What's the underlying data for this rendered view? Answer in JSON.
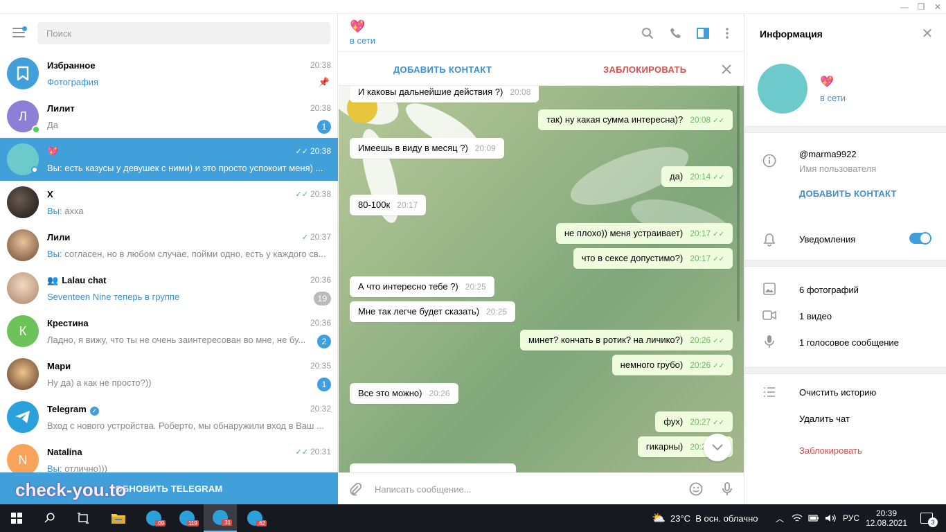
{
  "search": {
    "placeholder": "Поиск"
  },
  "chats": [
    {
      "name": "Избранное",
      "time": "20:38",
      "preview": "Фотография",
      "preview_you": "",
      "badge": "",
      "pinned": true
    },
    {
      "name": "Лилит",
      "time": "20:38",
      "preview": "Да",
      "preview_you": "",
      "badge": "1",
      "initial": "Л"
    },
    {
      "name": "💖",
      "time": "20:38",
      "preview": "есть казусы у девушек с ними) и это просто успокоит меня) ...",
      "preview_you": "Вы: ",
      "badge": ""
    },
    {
      "name": "X",
      "time": "20:38",
      "preview": "ахха",
      "preview_you": "Вы: ",
      "badge": ""
    },
    {
      "name": "Лили",
      "time": "20:37",
      "preview": "согласен, но в любом случае, пойми одно, есть у каждого св...",
      "preview_you": "Вы: ",
      "badge": ""
    },
    {
      "name": "Lalau chat",
      "time": "20:36",
      "preview": "Seventeen Nine теперь в группе",
      "preview_you": "",
      "badge": "19"
    },
    {
      "name": "Крестина",
      "time": "20:36",
      "preview": "Ладно, я вижу, что ты не очень заинтересован во мне, не бу...",
      "preview_you": "",
      "badge": "2",
      "initial": "К"
    },
    {
      "name": "Мари",
      "time": "20:35",
      "preview": "Ну да) а как не просто?))",
      "preview_you": "",
      "badge": "1"
    },
    {
      "name": "Telegram",
      "time": "20:32",
      "preview": "Вход с нового устройства. Роберто, мы обнаружили вход в Ваш ...",
      "preview_you": "",
      "badge": ""
    },
    {
      "name": "Natalina",
      "time": "20:31",
      "preview": "отлично)))",
      "preview_you": "Вы: ",
      "badge": "",
      "initial": "N"
    }
  ],
  "update_button": "ОБНОВИТЬ TELEGRAM",
  "watermark": "check-you.to",
  "header": {
    "title": "💖",
    "status": "в сети"
  },
  "actions": {
    "add_contact": "ДОБАВИТЬ КОНТАКТ",
    "block": "ЗАБЛОКИРОВАТЬ"
  },
  "messages": [
    {
      "text": "И каковы дальнейшие действия ?)",
      "time": "20:08",
      "dir": "in"
    },
    {
      "text": "так) ну какая сумма интересна)?",
      "time": "20:08",
      "dir": "out"
    },
    {
      "text": "Имеешь в виду в месяц ?)",
      "time": "20:09",
      "dir": "in"
    },
    {
      "text": "да)",
      "time": "20:14",
      "dir": "out"
    },
    {
      "text": "80-100к",
      "time": "20:17",
      "dir": "in"
    },
    {
      "text": "не плохо)) меня устраивает)",
      "time": "20:17",
      "dir": "out"
    },
    {
      "text": "что в сексе допустимо?)",
      "time": "20:17",
      "dir": "out"
    },
    {
      "text": "А что интересно тебе ?)",
      "time": "20:25",
      "dir": "in"
    },
    {
      "text": "Мне так легче будет сказать)",
      "time": "20:25",
      "dir": "in"
    },
    {
      "text": "минет? кончать в ротик? на личико?)",
      "time": "20:26",
      "dir": "out"
    },
    {
      "text": "немного грубо)",
      "time": "20:26",
      "dir": "out"
    },
    {
      "text": "Все это можно)",
      "time": "20:26",
      "dir": "in"
    },
    {
      "text": "фух)",
      "time": "20:27",
      "dir": "out"
    },
    {
      "text": "гикарны)",
      "time": "20:27",
      "dir": "out"
    }
  ],
  "composer": {
    "placeholder": "Написать сообщение..."
  },
  "info": {
    "title": "Информация",
    "name": "💖",
    "status": "в сети",
    "username": "@marma9922",
    "username_label": "Имя пользователя",
    "add_contact": "ДОБАВИТЬ КОНТАКТ",
    "notifications": "Уведомления",
    "notifications_on": true,
    "photos": "6 фотографий",
    "videos": "1 видео",
    "voice": "1 голосовое сообщение",
    "clear_history": "Очистить историю",
    "delete_chat": "Удалить чат",
    "block": "Заблокировать"
  },
  "taskbar": {
    "weather": "23°C  В осн. облачно",
    "lang": "РУС",
    "time": "20:39",
    "date": "12.08.2021",
    "notifications": "3",
    "app_badges": [
      ".09",
      "119",
      ".31",
      ".62"
    ]
  },
  "colors": {
    "accent": "#419fd9",
    "link": "#3d8fcf",
    "block": "#d14f4f",
    "outgoing": "#effdde",
    "online": "#4dcd5e"
  }
}
